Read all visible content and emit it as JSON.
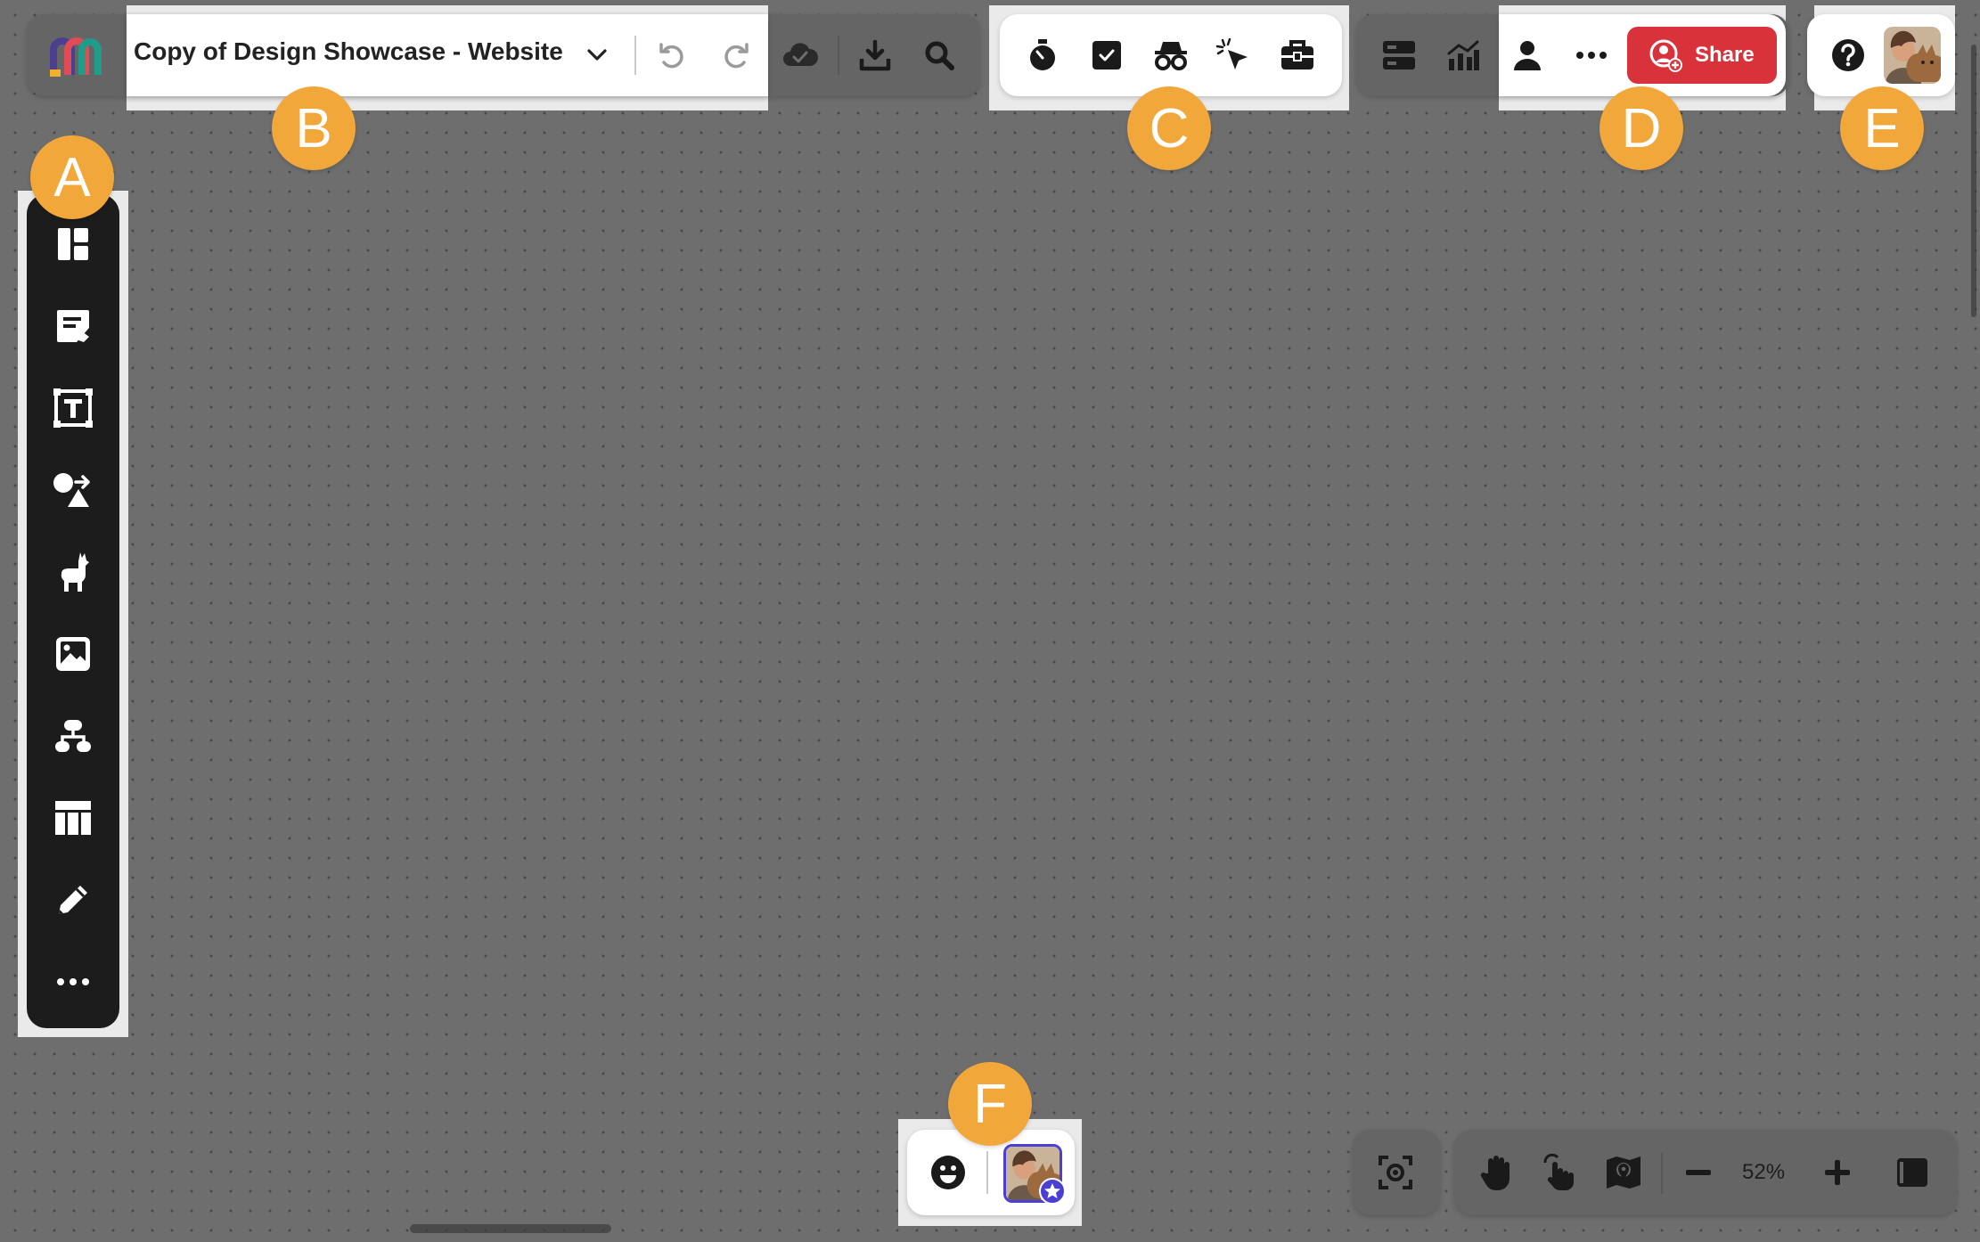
{
  "board": {
    "title": "Copy of Design Showcase - Website",
    "zoom_level": "52%"
  },
  "header": {
    "share_label": "Share",
    "share_color": "#d8333b"
  },
  "annotations": {
    "a": "A",
    "b": "B",
    "c": "C",
    "d": "D",
    "e": "E",
    "f": "F",
    "badge_color": "#f1a73a"
  },
  "icons": {
    "left_toolbar": [
      "templates-icon",
      "sticky-note-icon",
      "text-icon",
      "shapes-icon",
      "llama-icon",
      "image-icon",
      "mind-map-icon",
      "table-icon",
      "pen-icon",
      "more-icon"
    ],
    "board_menu": [
      "app-logo-icon",
      "chevron-down-icon",
      "undo-icon",
      "redo-icon",
      "cloud-saved-icon",
      "export-icon",
      "search-icon"
    ],
    "collaboration": [
      "timer-icon",
      "voting-icon",
      "private-mode-icon",
      "attention-icon",
      "toolkit-icon"
    ],
    "share_group": [
      "activity-icon",
      "analytics-icon",
      "user-icon",
      "more-icon",
      "share-icon"
    ],
    "help_group": [
      "help-icon",
      "avatar"
    ],
    "reactions": [
      "emoji-icon",
      "avatar"
    ],
    "navigation": [
      "focus-icon",
      "hand-icon",
      "pointer-hand-icon",
      "map-icon",
      "zoom-out-icon",
      "zoom-in-icon",
      "panel-icon"
    ]
  }
}
